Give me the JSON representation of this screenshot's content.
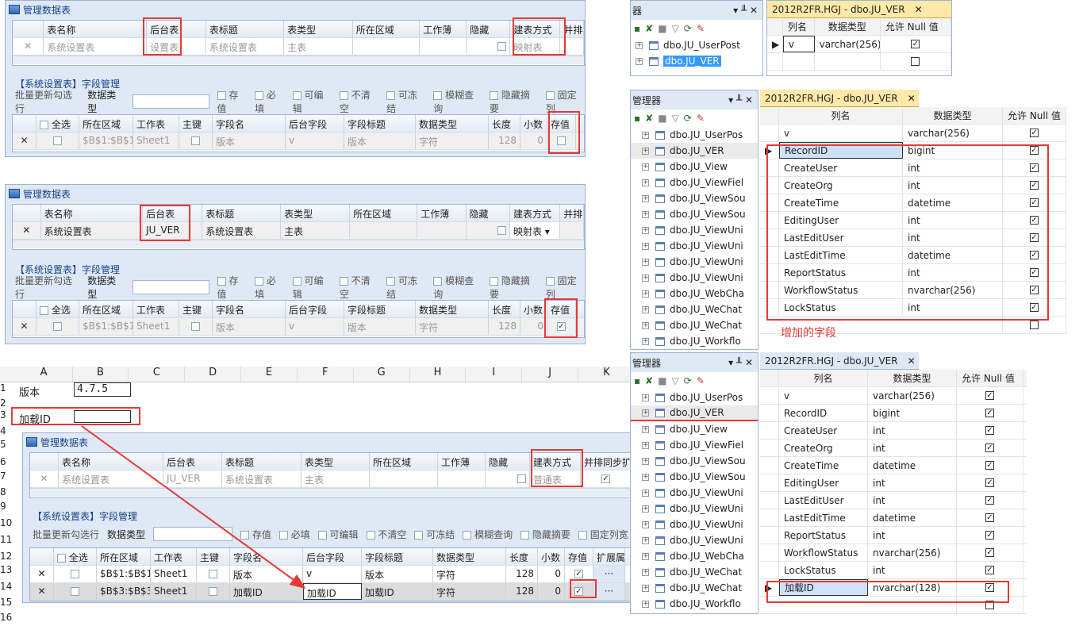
{
  "win1": {
    "title": "管理数据表",
    "cols": [
      "表名称",
      "后台表",
      "表标题",
      "表类型",
      "所在区域",
      "工作薄",
      "隐藏",
      "建表方式",
      "并排"
    ],
    "row": {
      "x": "✕",
      "name": "系统设置表",
      "back": "设置表",
      "title": "系统设置表",
      "type": "主表",
      "build": "映射表"
    },
    "section": "【系统设置表】字段管理",
    "toolbar": [
      "批量更新勾选行",
      "数据类型",
      "存值",
      "必填",
      "可编辑",
      "不清空",
      "可冻结",
      "模糊查询",
      "隐藏摘要",
      "固定列"
    ],
    "fcols": [
      "全选",
      "所在区域",
      "工作表",
      "主键",
      "字段名",
      "后台字段",
      "字段标题",
      "数据类型",
      "长度",
      "小数",
      "存值"
    ],
    "frow": {
      "area": "$B$1:$B$1",
      "sheet": "Sheet1",
      "field": "版本",
      "back": "v",
      "ftitle": "版本",
      "dtype": "字符",
      "len": "128",
      "dec": "0"
    }
  },
  "win2": {
    "title": "管理数据表",
    "cols": [
      "表名称",
      "后台表",
      "表标题",
      "表类型",
      "所在区域",
      "工作薄",
      "隐藏",
      "建表方式",
      "并排"
    ],
    "row": {
      "x": "✕",
      "name": "系统设置表",
      "back": "JU_VER",
      "title": "系统设置表",
      "type": "主表",
      "build": "映射表"
    },
    "section": "【系统设置表】字段管理",
    "toolbar": [
      "批量更新勾选行",
      "数据类型",
      "存值",
      "必填",
      "可编辑",
      "不清空",
      "可冻结",
      "模糊查询",
      "隐藏摘要",
      "固定列"
    ],
    "fcols": [
      "全选",
      "所在区域",
      "工作表",
      "主键",
      "字段名",
      "后台字段",
      "字段标题",
      "数据类型",
      "长度",
      "小数",
      "存值"
    ],
    "frow": {
      "area": "$B$1:$B$1",
      "sheet": "Sheet1",
      "field": "版本",
      "back": "v",
      "ftitle": "版本",
      "dtype": "字符",
      "len": "128",
      "dec": "0"
    }
  },
  "excel": {
    "colhdrs": [
      "A",
      "B",
      "C",
      "D",
      "E",
      "F",
      "G",
      "H",
      "I",
      "J",
      "K"
    ],
    "rownums": [
      "1",
      "2",
      "3",
      "4",
      "5",
      "6",
      "7",
      "8",
      "9",
      "10",
      "11",
      "12",
      "13",
      "14",
      "15",
      "16"
    ],
    "a1": "版本",
    "b1": "4.7.5",
    "a3": "加载ID"
  },
  "win3": {
    "title": "管理数据表",
    "cols": [
      "表名称",
      "后台表",
      "表标题",
      "表类型",
      "所在区域",
      "工作薄",
      "隐藏",
      "建表方式",
      "并排同步扩"
    ],
    "row": {
      "x": "✕",
      "name": "系统设置表",
      "back": "JU_VER",
      "title": "系统设置表",
      "type": "主表",
      "build": "普通表"
    },
    "section": "【系统设置表】字段管理",
    "toolbar": [
      "批量更新勾选行",
      "数据类型",
      "存值",
      "必填",
      "可编辑",
      "不清空",
      "可冻结",
      "模糊查询",
      "隐藏摘要",
      "固定列宽"
    ],
    "fcols": [
      "全选",
      "所在区域",
      "工作表",
      "主键",
      "字段名",
      "后台字段",
      "字段标题",
      "数据类型",
      "长度",
      "小数",
      "存值",
      "扩展属"
    ],
    "frows": [
      {
        "area": "$B$1:$B$1",
        "sheet": "Sheet1",
        "field": "版本",
        "back": "v",
        "ftitle": "版本",
        "dtype": "字符",
        "len": "128",
        "dec": "0"
      },
      {
        "area": "$B$3:$B$3",
        "sheet": "Sheet1",
        "field": "加载ID",
        "back": "加载ID",
        "ftitle": "加载ID",
        "dtype": "字符",
        "len": "128",
        "dec": "0"
      }
    ]
  },
  "ssms1": {
    "explorer": "器",
    "tab": "2012R2FR.HGJ - dbo.JU_VER",
    "hdr": [
      "列名",
      "数据类型",
      "允许 Null 值"
    ],
    "tree": [
      "dbo.JU_UserPost",
      "dbo.JU_VER"
    ],
    "rows": [
      {
        "n": "v",
        "t": "varchar(256)",
        "c": "✓"
      },
      {
        "n": "",
        "t": "",
        "c": ""
      }
    ]
  },
  "ssms2": {
    "explorer": "管理器",
    "tab": "2012R2FR.HGJ - dbo.JU_VER",
    "hdr": [
      "列名",
      "数据类型",
      "允许 Null 值"
    ],
    "tree": [
      "dbo.JU_UserPos",
      "dbo.JU_VER",
      "dbo.JU_View",
      "dbo.JU_ViewFiel",
      "dbo.JU_ViewSou",
      "dbo.JU_ViewSou",
      "dbo.JU_ViewUni",
      "dbo.JU_ViewUni",
      "dbo.JU_ViewUni",
      "dbo.JU_ViewUni",
      "dbo.JU_WebCha",
      "dbo.JU_WeChat",
      "dbo.JU_WeChat",
      "dbo.JU_Workflo"
    ],
    "rows": [
      {
        "n": "v",
        "t": "varchar(256)"
      },
      {
        "n": "RecordID",
        "t": "bigint"
      },
      {
        "n": "CreateUser",
        "t": "int"
      },
      {
        "n": "CreateOrg",
        "t": "int"
      },
      {
        "n": "CreateTime",
        "t": "datetime"
      },
      {
        "n": "EditingUser",
        "t": "int"
      },
      {
        "n": "LastEditUser",
        "t": "int"
      },
      {
        "n": "LastEditTime",
        "t": "datetime"
      },
      {
        "n": "ReportStatus",
        "t": "int"
      },
      {
        "n": "WorkflowStatus",
        "t": "nvarchar(256)"
      },
      {
        "n": "LockStatus",
        "t": "int"
      }
    ],
    "note": "增加的字段"
  },
  "ssms3": {
    "explorer": "管理器",
    "tab": "2012R2FR.HGJ - dbo.JU_VER",
    "hdr": [
      "列名",
      "数据类型",
      "允许 Null 值"
    ],
    "tree": [
      "dbo.JU_UserPos",
      "dbo.JU_VER",
      "dbo.JU_View",
      "dbo.JU_ViewFiel",
      "dbo.JU_ViewSou",
      "dbo.JU_ViewSou",
      "dbo.JU_ViewUni",
      "dbo.JU_ViewUni",
      "dbo.JU_ViewUni",
      "dbo.JU_ViewUni",
      "dbo.JU_WebCha",
      "dbo.JU_WeChat",
      "dbo.JU_WeChat",
      "dbo.JU_Workflo"
    ],
    "rows": [
      {
        "n": "v",
        "t": "varchar(256)"
      },
      {
        "n": "RecordID",
        "t": "bigint"
      },
      {
        "n": "CreateUser",
        "t": "int"
      },
      {
        "n": "CreateOrg",
        "t": "int"
      },
      {
        "n": "CreateTime",
        "t": "datetime"
      },
      {
        "n": "EditingUser",
        "t": "int"
      },
      {
        "n": "LastEditUser",
        "t": "int"
      },
      {
        "n": "LastEditTime",
        "t": "datetime"
      },
      {
        "n": "ReportStatus",
        "t": "int"
      },
      {
        "n": "WorkflowStatus",
        "t": "nvarchar(256)"
      },
      {
        "n": "LockStatus",
        "t": "int"
      },
      {
        "n": "加载ID",
        "t": "nvarchar(128)"
      }
    ]
  }
}
